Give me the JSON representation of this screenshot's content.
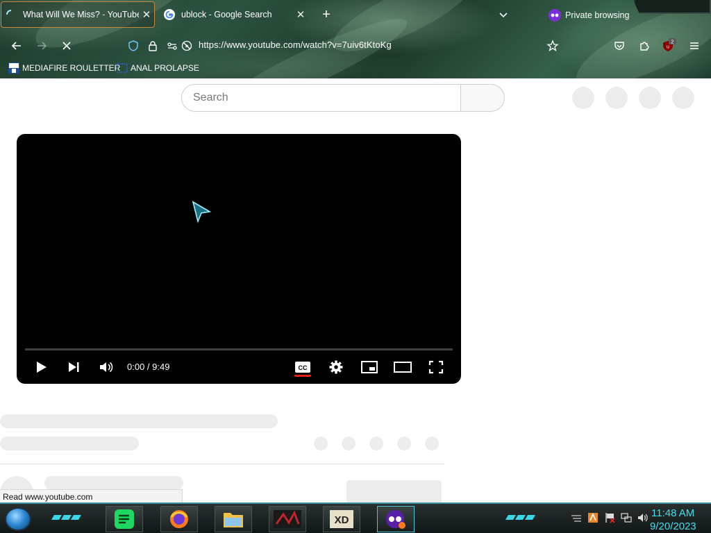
{
  "browser": {
    "tabs": [
      {
        "title": "What Will We Miss? - YouTube",
        "active": true,
        "icon": "loading-spinner-icon"
      },
      {
        "title": "ublock - Google Search",
        "active": false,
        "icon": "google-icon"
      }
    ],
    "private_label": "Private browsing",
    "url": "https://www.youtube.com/watch?v=7uiv6tKtoKg",
    "extension_badge": "2",
    "bookmarks": [
      {
        "label": "MEDIAFIRE ROULETTER",
        "icon": "mft-icon"
      },
      {
        "label": "ANAL PROLAPSE",
        "icon": "folder-icon"
      }
    ]
  },
  "youtube": {
    "search_placeholder": "Search",
    "player": {
      "time": "0:00 / 9:49",
      "progress": 0,
      "captions_enabled": true
    }
  },
  "status_bar": "Read www.youtube.com",
  "taskbar": {
    "apps": [
      "spotify",
      "firefox",
      "file-explorer",
      "game",
      "xd-app",
      "firefox-private"
    ],
    "time": "11:48 AM",
    "date": "9/20/2023"
  },
  "colors": {
    "accent_cyan": "#3fe0ee",
    "caption_red": "#e62117",
    "tab_border": "#c78a3a"
  }
}
